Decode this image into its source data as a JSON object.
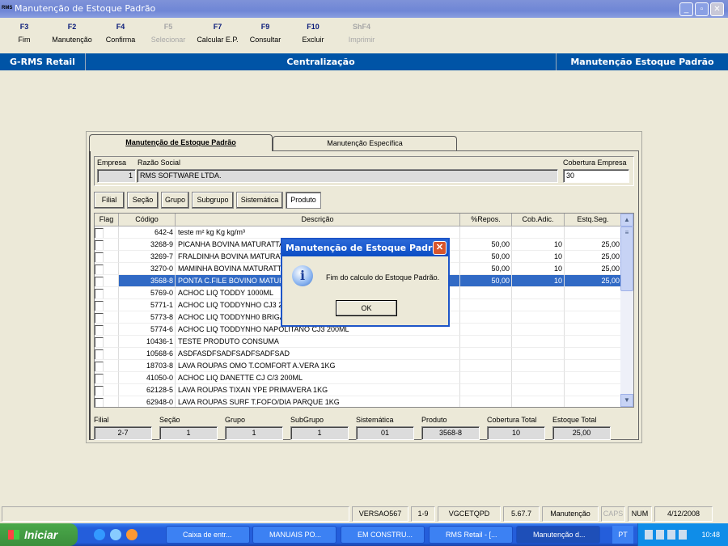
{
  "window": {
    "title": "Manutenção de Estoque Padrão",
    "app_icon": "RMS",
    "controls": [
      "minimize",
      "maximize",
      "close"
    ]
  },
  "toolbar": [
    {
      "key": "F3",
      "label": "Fim",
      "enabled": true
    },
    {
      "key": "F2",
      "label": "Manutenção",
      "enabled": true
    },
    {
      "key": "F4",
      "label": "Confirma",
      "enabled": true
    },
    {
      "key": "F5",
      "label": "Selecionar",
      "enabled": false
    },
    {
      "key": "F7",
      "label": "Calcular E.P.",
      "enabled": true
    },
    {
      "key": "F9",
      "label": "Consultar",
      "enabled": true
    },
    {
      "key": "F10",
      "label": "Excluir",
      "enabled": true
    },
    {
      "key": "ShF4",
      "label": "Imprimir",
      "enabled": false
    }
  ],
  "banner": {
    "left": "G-RMS Retail",
    "center": "Centralização",
    "right": "Manutenção Estoque Padrão"
  },
  "tabs": [
    {
      "label": "Manutenção de Estoque Padrão",
      "active": true
    },
    {
      "label": "Manutenção Específica",
      "active": false
    }
  ],
  "empresa": {
    "empresa_label": "Empresa",
    "empresa_value": "1",
    "razao_label": "Razão Social",
    "razao_value": "RMS SOFTWARE LTDA.",
    "cobertura_label": "Cobertura Empresa",
    "cobertura_value": "30"
  },
  "filter_buttons": [
    "Filial",
    "Seção",
    "Grupo",
    "Subgrupo",
    "Sistemática",
    "Produto"
  ],
  "grid": {
    "columns": [
      "Flag",
      "Código",
      "Descrição",
      "%Repos.",
      "Cob.Adic.",
      "Estq.Seg."
    ],
    "rows": [
      {
        "codigo": "642-4",
        "descricao": "teste m² kg Kg kg/m³",
        "repos": "",
        "cob": "",
        "estq": ""
      },
      {
        "codigo": "3268-9",
        "descricao": "PICANHA BOVINA MATURATTA",
        "repos": "50,00",
        "cob": "10",
        "estq": "25,00"
      },
      {
        "codigo": "3269-7",
        "descricao": "FRALDINHA BOVINA MATURATTA",
        "repos": "50,00",
        "cob": "10",
        "estq": "25,00"
      },
      {
        "codigo": "3270-0",
        "descricao": "MAMINHA BOVINA MATURATTA",
        "repos": "50,00",
        "cob": "10",
        "estq": "25,00"
      },
      {
        "codigo": "3568-8",
        "descricao": "PONTA C.FILE BOVINO MATURATTA",
        "repos": "50,00",
        "cob": "10",
        "estq": "25,00",
        "selected": true
      },
      {
        "codigo": "5769-0",
        "descricao": "ACHOC LIQ TODDY 1000ML",
        "repos": "",
        "cob": "",
        "estq": ""
      },
      {
        "codigo": "5771-1",
        "descricao": "ACHOC LIQ TODDYNHO CJ3 200ML",
        "repos": "",
        "cob": "",
        "estq": ""
      },
      {
        "codigo": "5773-8",
        "descricao": "ACHOC LIQ TODDYNH0 BRIGADEIRO",
        "repos": "",
        "cob": "",
        "estq": ""
      },
      {
        "codigo": "5774-6",
        "descricao": "ACHOC LIQ TODDYNHO NAPOLITANO CJ3 200ML",
        "repos": "",
        "cob": "",
        "estq": ""
      },
      {
        "codigo": "10436-1",
        "descricao": "TESTE PRODUTO CONSUMA",
        "repos": "",
        "cob": "",
        "estq": ""
      },
      {
        "codigo": "10568-6",
        "descricao": "ASDFASDFSADFSADFSADFSAD",
        "repos": "",
        "cob": "",
        "estq": ""
      },
      {
        "codigo": "18703-8",
        "descricao": "LAVA ROUPAS OMO T.COMFORT A.VERA 1KG",
        "repos": "",
        "cob": "",
        "estq": ""
      },
      {
        "codigo": "41050-0",
        "descricao": "ACHOC LIQ DANETTE CJ C/3 200ML",
        "repos": "",
        "cob": "",
        "estq": ""
      },
      {
        "codigo": "62128-5",
        "descricao": "LAVA ROUPAS TIXAN YPE PRIMAVERA 1KG",
        "repos": "",
        "cob": "",
        "estq": ""
      },
      {
        "codigo": "62948-0",
        "descricao": "LAVA ROUPAS SURF T.FOFO/DIA PARQUE 1KG",
        "repos": "",
        "cob": "",
        "estq": ""
      }
    ]
  },
  "summary": [
    {
      "label": "Filial",
      "value": "2-7"
    },
    {
      "label": "Seção",
      "value": "1"
    },
    {
      "label": "Grupo",
      "value": "1"
    },
    {
      "label": "SubGrupo",
      "value": "1"
    },
    {
      "label": "Sistemática",
      "value": "01"
    },
    {
      "label": "Produto",
      "value": "3568-8"
    },
    {
      "label": "Cobertura Total",
      "value": "10"
    },
    {
      "label": "Estoque Total",
      "value": "25,00"
    }
  ],
  "dialog": {
    "title": "Manutenção de Estoque Padrão",
    "message": "Fim do calculo do Estoque Padrão.",
    "ok": "OK",
    "icon": "info-icon"
  },
  "statusbar": [
    "VERSAO567",
    "1-9",
    "VGCETQPD",
    "5.67.7",
    "Manutenção",
    "CAPS",
    "NUM",
    "4/12/2008"
  ],
  "taskbar": {
    "start": "Iniciar",
    "items": [
      "Caixa de entr...",
      "MANUAIS PO...",
      "EM CONSTRU...",
      "RMS Retail - [...",
      "Manutenção d..."
    ],
    "language": "PT",
    "clock": "10:48"
  }
}
